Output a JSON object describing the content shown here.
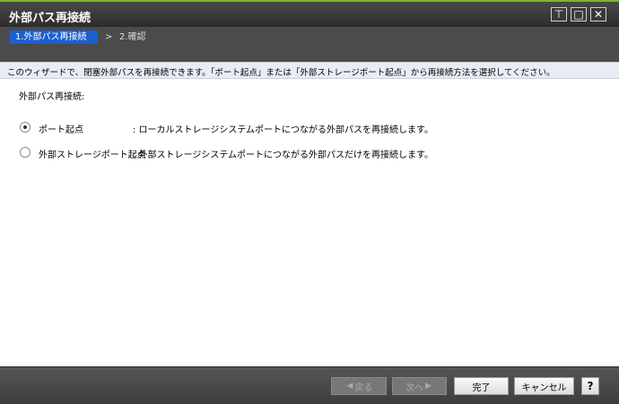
{
  "window": {
    "title": "外部パス再接続",
    "controls": {
      "pin": "⊤",
      "maximize": "□",
      "close": "✕"
    }
  },
  "breadcrumb": {
    "step1": "1.外部パス再接続",
    "separator": ">",
    "step2": "2.確認"
  },
  "info": "このウィザードで、閉塞外部パスを再接続できます。「ポート起点」または「外部ストレージポート起点」から再接続方法を選択してください。",
  "section_label": "外部パス再接続:",
  "options": [
    {
      "label": "ポート起点",
      "desc": ": ローカルストレージシステムポートにつながる外部パスを再接続します。",
      "selected": true
    },
    {
      "label": "外部ストレージポート起点",
      "desc": ": 外部ストレージシステムポートにつながる外部パスだけを再接続します。",
      "selected": false
    }
  ],
  "footer": {
    "back": "戻る",
    "next": "次へ",
    "finish": "完了",
    "cancel": "キャンセル",
    "help": "?"
  },
  "colors": {
    "accent": "#1c5fcf",
    "title_border": "#7fb531"
  }
}
